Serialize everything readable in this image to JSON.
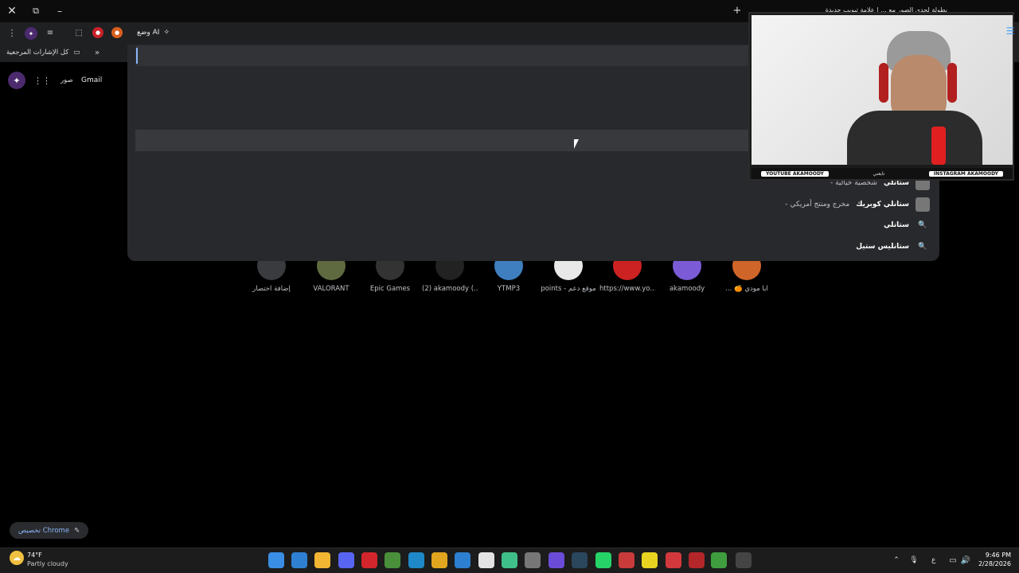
{
  "browser": {
    "ai_mode_label": "وضع AI",
    "bookmarks_all_label": "كل الإشارات المرجعية",
    "tab_title": "بطولة لحدي الصور مع ... | علامة تبويب جديدة"
  },
  "google_header": {
    "gmail_label": "Gmail",
    "images_label": "صور"
  },
  "suggestions": [
    {
      "bold": "ستانلي كوبريك",
      "rest": " - مخرج ومنتج أمريكي",
      "type": "image"
    },
    {
      "bold": "ستانلي",
      "rest": "",
      "type": "search"
    },
    {
      "bold": "ستانليس ستيل",
      "rest": "",
      "type": "search"
    }
  ],
  "partial_suggestion": {
    "bold": "ستانلي",
    "rest": " - شخصية خيالية"
  },
  "webcam": {
    "youtube_label": "YOUTUBE AKAMOODY",
    "instagram_label": "INSTAGRAM AKAMOODY",
    "center_label": "تابعني"
  },
  "shortcuts": [
    {
      "label": "إضافة اختصار",
      "color": "#3a3b3e"
    },
    {
      "label": "VALORANT",
      "color": "#5f6a40"
    },
    {
      "label": "Epic Games",
      "color": "#333"
    },
    {
      "label": "(2) akamoody (...",
      "color": "#222"
    },
    {
      "label": "YTMP3",
      "color": "#3f7fbf"
    },
    {
      "label": "points - موقع دعم",
      "color": "#e8e8e8"
    },
    {
      "label": "https://www.yo...",
      "color": "#cc2222"
    },
    {
      "label": "akamoody",
      "color": "#7b5cd6"
    },
    {
      "label": "... 🍊 ابا مودي",
      "color": "#d0652a"
    }
  ],
  "customize_label": "تخصيص Chrome",
  "taskbar": {
    "weather_temp": "74°F",
    "weather_desc": "Partly cloudy",
    "time": "9:46 PM",
    "date": "2/28/2026",
    "lang": "ع"
  },
  "colors": {
    "accent": "#8ab4f8",
    "dropdown_bg": "#28292c",
    "toolbar_bg": "#1f2022"
  }
}
